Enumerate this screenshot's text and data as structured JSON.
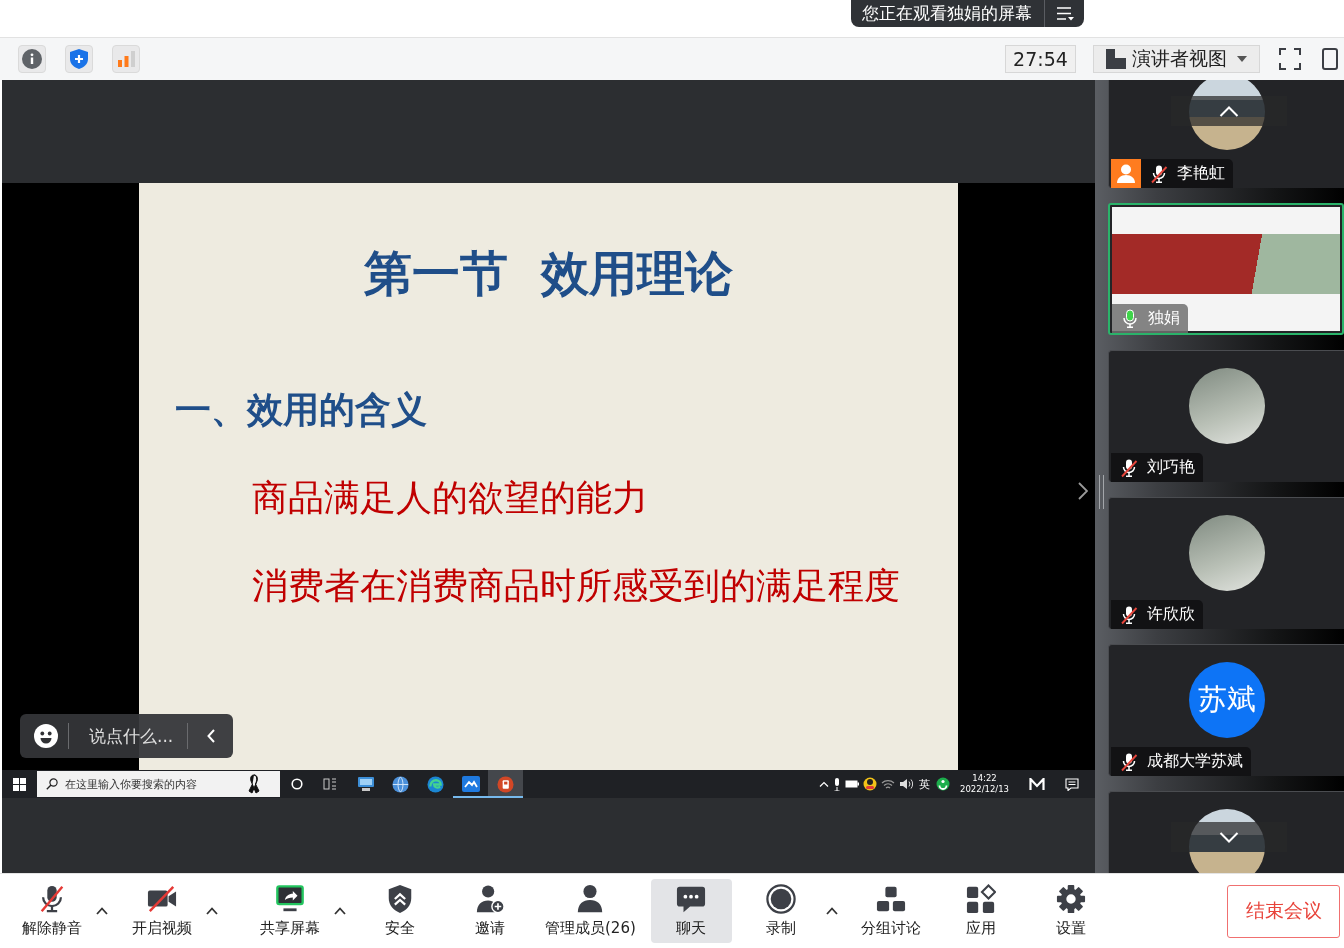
{
  "share_banner": {
    "text": "您正在观看独娟的屏幕"
  },
  "top_toolbar": {
    "timer": "27:54",
    "view_menu": {
      "label": "演讲者视图"
    }
  },
  "shared_screen": {
    "slide": {
      "title": "第一节  效用理论",
      "heading": "一、效用的含义",
      "points": [
        "商品满足人的欲望的能力",
        "消费者在消费商品时所感受到的满足程度"
      ]
    },
    "taskbar": {
      "search": {
        "placeholder": "在这里输入你要搜索的内容"
      },
      "apps": [
        {
          "kind": "monitor",
          "open": false,
          "selected": false
        },
        {
          "kind": "globe",
          "open": false,
          "selected": false
        },
        {
          "kind": "browser",
          "open": false,
          "selected": false
        },
        {
          "kind": "meeting",
          "open": true,
          "selected": false
        },
        {
          "kind": "slides",
          "open": true,
          "selected": true
        }
      ],
      "input_method": "英",
      "time": "14:22",
      "date": "2022/12/13"
    },
    "chat_input": {
      "placeholder": "说点什么..."
    }
  },
  "participants": [
    {
      "view": {
        "kind": "scenery"
      },
      "speaking": false,
      "name_tag": {
        "name": "李艳虹",
        "muted": true,
        "host": true
      }
    },
    {
      "view": {
        "kind": "video"
      },
      "speaking": true,
      "name_tag": {
        "name": "独娟",
        "muted": false,
        "host": false
      }
    },
    {
      "view": {
        "kind": "portrait"
      },
      "speaking": false,
      "name_tag": {
        "name": "刘巧艳",
        "muted": true,
        "host": false
      }
    },
    {
      "view": {
        "kind": "portrait"
      },
      "speaking": false,
      "name_tag": {
        "name": "许欣欣",
        "muted": true,
        "host": false
      }
    },
    {
      "view": {
        "kind": "initials",
        "text": "苏斌"
      },
      "speaking": false,
      "name_tag": {
        "name": "成都大学苏斌",
        "muted": true,
        "host": false
      }
    },
    {
      "view": {
        "kind": "scenery"
      },
      "speaking": false
    }
  ],
  "bottom_toolbar": {
    "buttons": [
      {
        "kind": "mic",
        "label": "解除静音",
        "dropdown": true,
        "selected": false
      },
      {
        "kind": "camera",
        "label": "开启视频",
        "dropdown": true,
        "selected": false
      },
      {
        "kind": "share",
        "label": "共享屏幕",
        "dropdown": true,
        "selected": false
      },
      {
        "kind": "security",
        "label": "安全",
        "dropdown": false,
        "selected": false
      },
      {
        "kind": "invite",
        "label": "邀请",
        "dropdown": false,
        "selected": false
      },
      {
        "kind": "members",
        "label": "管理成员(26)",
        "dropdown": false,
        "selected": false
      },
      {
        "kind": "chat",
        "label": "聊天",
        "dropdown": false,
        "selected": true
      },
      {
        "kind": "record",
        "label": "录制",
        "dropdown": true,
        "selected": false
      },
      {
        "kind": "breakout",
        "label": "分组讨论",
        "dropdown": false,
        "selected": false
      },
      {
        "kind": "apps",
        "label": "应用",
        "dropdown": false,
        "selected": false
      },
      {
        "kind": "settings",
        "label": "设置",
        "dropdown": false,
        "selected": false
      }
    ],
    "end_button": {
      "label": "结束会议"
    }
  }
}
